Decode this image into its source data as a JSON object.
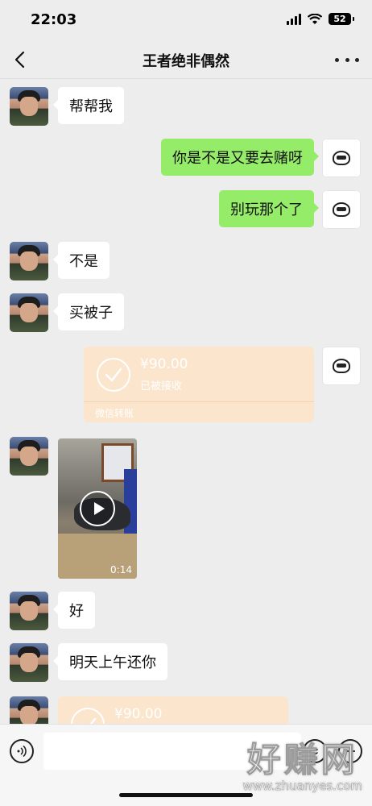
{
  "status_bar": {
    "time": "22:03",
    "battery": "52"
  },
  "header": {
    "title": "王者绝非偶然"
  },
  "messages": {
    "m1": {
      "text": "帮帮我"
    },
    "m2": {
      "text": "你是不是又要去赌呀"
    },
    "m3": {
      "text": "别玩那个了"
    },
    "m4": {
      "text": "不是"
    },
    "m5": {
      "text": "买被子"
    },
    "transfer1": {
      "amount": "¥90.00",
      "status": "已被接收",
      "footer": "微信转账"
    },
    "video": {
      "duration": "0:14"
    },
    "m6": {
      "text": "好"
    },
    "m7": {
      "text": "明天上午还你"
    },
    "transfer2": {
      "amount": "¥90.00"
    }
  },
  "input": {
    "value": ""
  },
  "watermark": {
    "brand": "好赚网",
    "domain": "www.zhuanyes.com"
  },
  "colors": {
    "green_bubble": "#95ec69",
    "transfer_bg": "#fbe5cc",
    "background": "#ededed"
  },
  "icons": [
    "back-icon",
    "more-icon",
    "voice-icon",
    "emoji-icon",
    "plus-icon",
    "check-icon",
    "play-icon"
  ]
}
